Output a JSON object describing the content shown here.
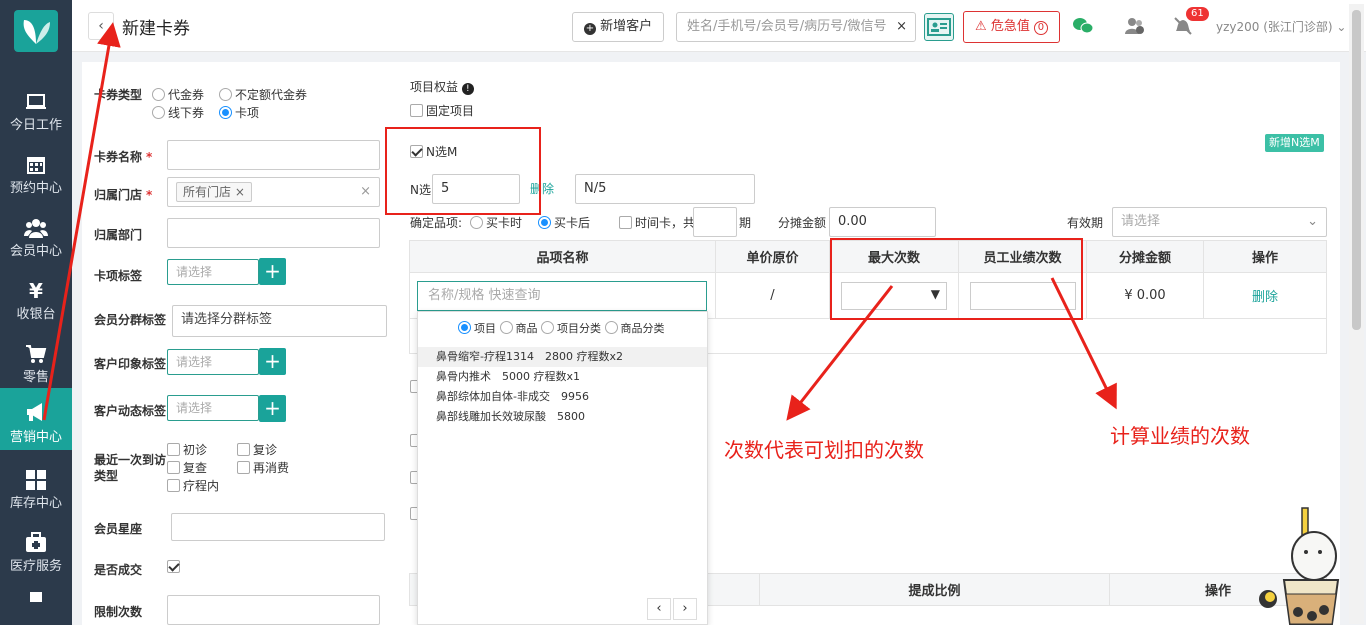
{
  "sidebar": {
    "items": [
      {
        "label": "今日工作",
        "icon": "laptop-icon"
      },
      {
        "label": "预约中心",
        "icon": "calendar-icon"
      },
      {
        "label": "会员中心",
        "icon": "users-icon"
      },
      {
        "label": "收银台",
        "icon": "yen-icon"
      },
      {
        "label": "零售",
        "icon": "cart-icon"
      },
      {
        "label": "营销中心",
        "icon": "megaphone-icon"
      },
      {
        "label": "库存中心",
        "icon": "grid-icon"
      },
      {
        "label": "医疗服务",
        "icon": "medkit-icon"
      }
    ],
    "active": "营销中心"
  },
  "header": {
    "back": "‹",
    "title": "新建卡券",
    "new_customer": "新增客户",
    "search_placeholder": "姓名/手机号/会员号/病历号/微信号",
    "search_clear": "×",
    "emergency": "危急值",
    "emergency_count": "0",
    "notif_count": "61",
    "user": "yzy200 (张江门诊部)"
  },
  "form": {
    "card_type_label": "卡券类型",
    "card_type_options": [
      "代金券",
      "不定额代金券",
      "线下券",
      "卡项"
    ],
    "card_type_selected": "卡项",
    "name_label": "卡券名称",
    "store_label": "归属门店",
    "store_tag": "所有门店",
    "store_tag_x": "×",
    "store_clear": "×",
    "dept_label": "归属部门",
    "card_tag_label": "卡项标签",
    "select_placeholder": "请选择",
    "group_tag_label": "会员分群标签",
    "group_tag_placeholder": "请选择分群标签",
    "impression_label": "客户印象标签",
    "dynamic_label": "客户动态标签",
    "last_visit_label": "最近一次到访类型",
    "visit_options": [
      "初诊",
      "复诊",
      "复查",
      "再消费",
      "疗程内"
    ],
    "zodiac_label": "会员星座",
    "deal_label": "是否成交",
    "limit_label": "限制次数"
  },
  "project": {
    "rights_label": "项目权益",
    "info_icon": "❗",
    "fixed_label": "固定项目",
    "nm_label": "N选M",
    "n_label": "N选",
    "n_value": "5",
    "delete": "删除",
    "n_ratio": "N/5",
    "item_label": "确定品项:",
    "buy_time": "买卡时",
    "after_buy": "买卡后",
    "time_card": "时间卡，共",
    "period": "期",
    "allocate_label": "分摊金额",
    "allocate_value": "0.00",
    "valid_label": "有效期",
    "valid_placeholder": "请选择",
    "add_nm": "新增N选M"
  },
  "table": {
    "headers": [
      "品项名称",
      "单价原价",
      "最大次数",
      "员工业绩次数",
      "分摊金额",
      "操作"
    ],
    "search_placeholder": "名称/规格 快速查询",
    "price": "/",
    "amount": "¥ 0.00",
    "delete": "删除"
  },
  "dropdown": {
    "radios": [
      "项目",
      "商品",
      "项目分类",
      "商品分类"
    ],
    "selected": "项目",
    "items": [
      "鼻骨缩窄-疗程1314　2800 疗程数x2",
      "鼻骨内推术　5000 疗程数x1",
      "鼻部综体加自体-非成交　9956",
      "鼻部线雕加长效玻尿酸　5800"
    ],
    "prev": "‹",
    "next": "›"
  },
  "bottom_table": {
    "headers": [
      "",
      "提成比例",
      "操作"
    ]
  },
  "annotations": {
    "max_times": "次数代表可划扣的次数",
    "perf_times": "计算业绩的次数"
  }
}
